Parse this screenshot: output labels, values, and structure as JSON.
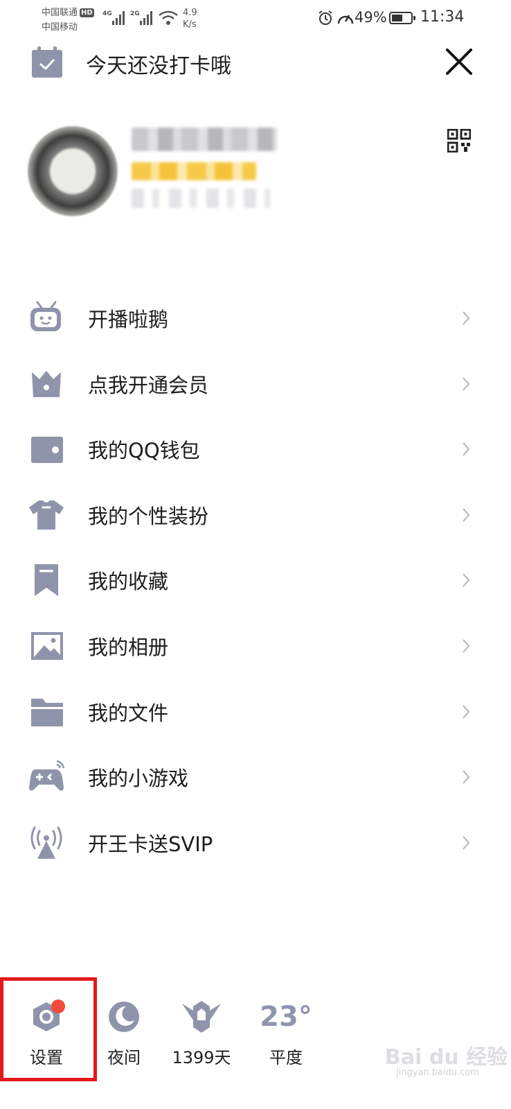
{
  "status_bar": {
    "carrier_1": "中国联通",
    "hd_badge": "HD",
    "carrier_2": "中国移动",
    "net_1": "4G",
    "net_2": "2G",
    "speed_value": "4.9",
    "speed_unit": "K/s",
    "battery": "49%",
    "battery_level": 0.49,
    "time": "11:34"
  },
  "header": {
    "checkin_text": "今天还没打卡哦"
  },
  "menu": {
    "items": [
      {
        "label": "开播啦鹅",
        "icon": "tv-robot-icon"
      },
      {
        "label": "点我开通会员",
        "icon": "crown-bag-icon"
      },
      {
        "label": "我的QQ钱包",
        "icon": "wallet-icon"
      },
      {
        "label": "我的个性装扮",
        "icon": "tshirt-icon"
      },
      {
        "label": "我的收藏",
        "icon": "bookmark-icon"
      },
      {
        "label": "我的相册",
        "icon": "photo-icon"
      },
      {
        "label": "我的文件",
        "icon": "folder-icon"
      },
      {
        "label": "我的小游戏",
        "icon": "gamepad-icon"
      },
      {
        "label": "开王卡送SVIP",
        "icon": "signal-tower-icon"
      }
    ]
  },
  "bottom_bar": {
    "settings_label": "设置",
    "night_label": "夜间",
    "days_label": "1399天",
    "weather_temp": "23°",
    "weather_label": "平度"
  },
  "watermark": {
    "brand": "Bai du 经验",
    "url": "jingyan.baidu.com"
  },
  "colors": {
    "icon_gray": "#8e95ab",
    "highlight_red": "#e3191c",
    "badge_red": "#f24a3d"
  }
}
